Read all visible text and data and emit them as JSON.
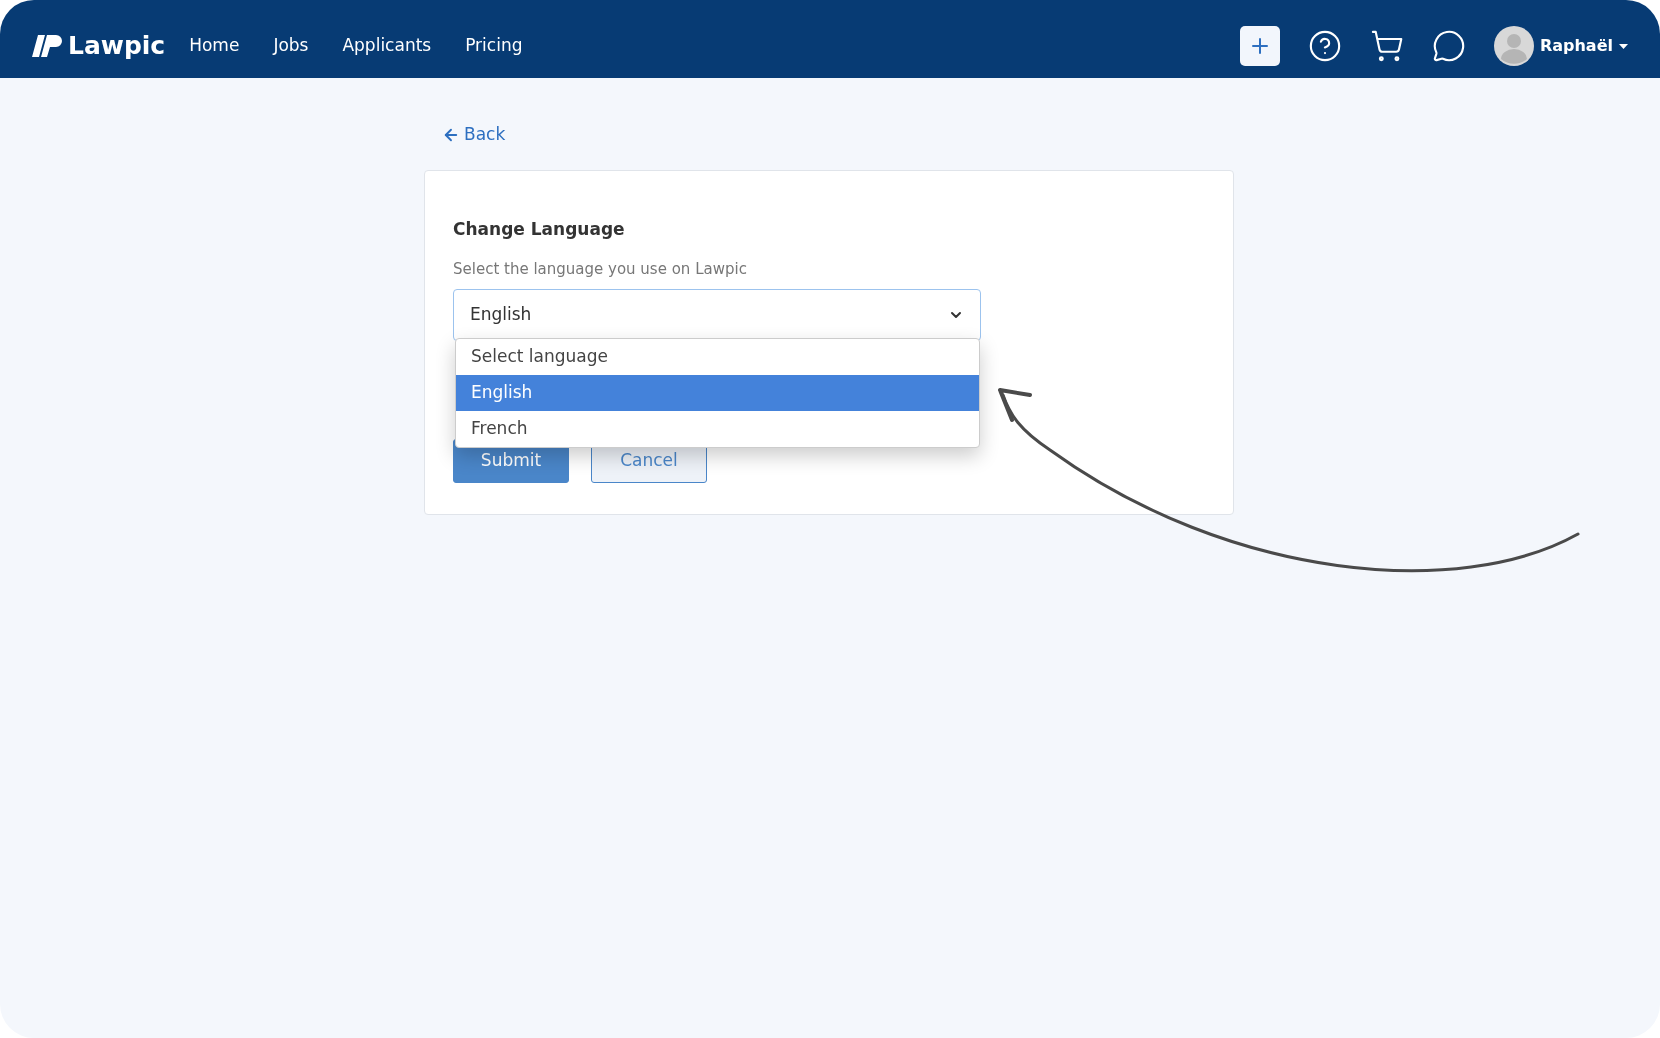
{
  "header": {
    "logo": "Lawpic",
    "nav": [
      {
        "label": "Home"
      },
      {
        "label": "Jobs"
      },
      {
        "label": "Applicants"
      },
      {
        "label": "Pricing"
      }
    ],
    "user": "Raphaël"
  },
  "back": "Back",
  "card": {
    "title": "Change Language",
    "hint": "Select the language you use on Lawpic",
    "select": {
      "value": "English",
      "expanded": true,
      "options": [
        {
          "label": "Select language",
          "selected": false
        },
        {
          "label": "English",
          "selected": true
        },
        {
          "label": "French",
          "selected": false
        }
      ]
    },
    "buttons": [
      {
        "label": "Submit",
        "kind": "primary"
      },
      {
        "label": "Cancel",
        "kind": "outline"
      }
    ]
  }
}
